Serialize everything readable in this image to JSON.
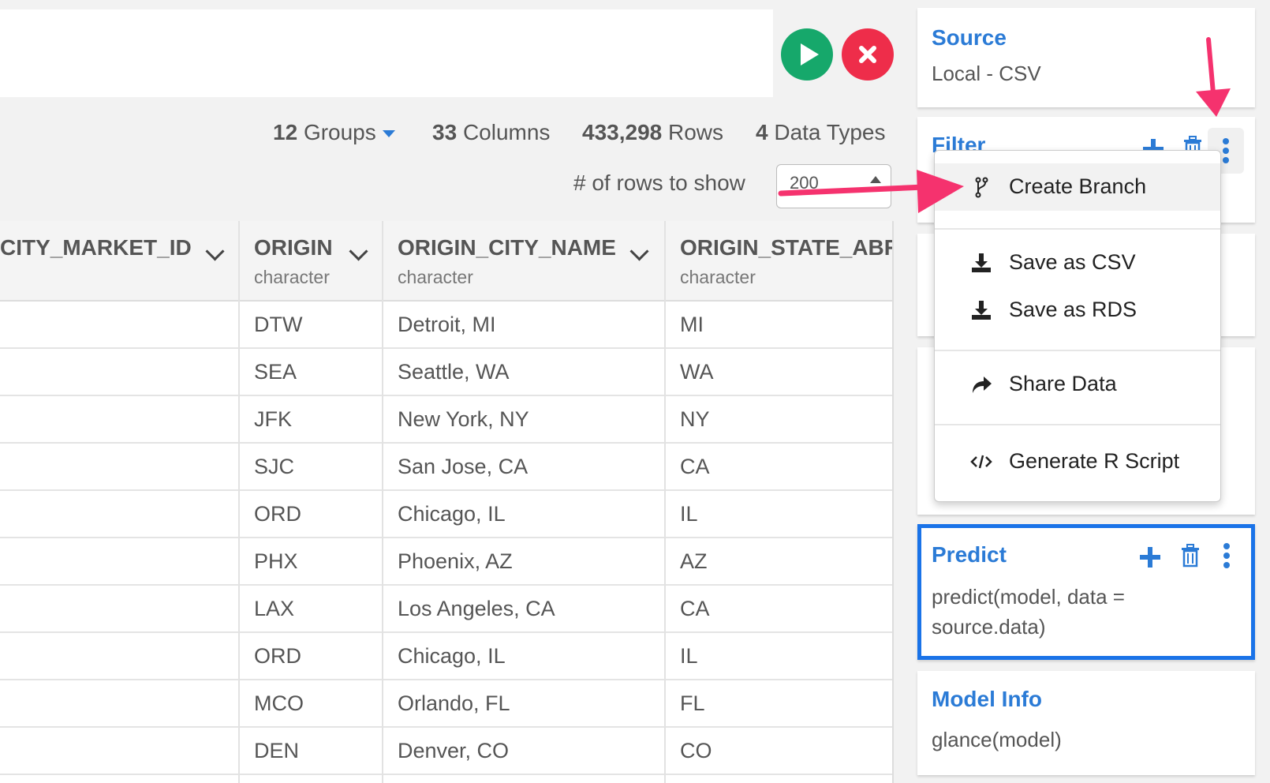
{
  "stats": {
    "groups_count": "12",
    "groups_label": "Groups",
    "columns_count": "33",
    "columns_label": "Columns",
    "rows_count": "433,298",
    "rows_label": "Rows",
    "types_count": "4",
    "types_label": "Data Types"
  },
  "rows_to_show": {
    "label": "# of rows to show",
    "value": "200"
  },
  "table": {
    "columns": [
      {
        "name": "CITY_MARKET_ID",
        "type": ""
      },
      {
        "name": "ORIGIN",
        "type": "character"
      },
      {
        "name": "ORIGIN_CITY_NAME",
        "type": "character"
      },
      {
        "name": "ORIGIN_STATE_ABR",
        "type": "character"
      }
    ],
    "rows": [
      [
        "DTW",
        "Detroit, MI",
        "MI"
      ],
      [
        "SEA",
        "Seattle, WA",
        "WA"
      ],
      [
        "JFK",
        "New York, NY",
        "NY"
      ],
      [
        "SJC",
        "San Jose, CA",
        "CA"
      ],
      [
        "ORD",
        "Chicago, IL",
        "IL"
      ],
      [
        "PHX",
        "Phoenix, AZ",
        "AZ"
      ],
      [
        "LAX",
        "Los Angeles, CA",
        "CA"
      ],
      [
        "ORD",
        "Chicago, IL",
        "IL"
      ],
      [
        "MCO",
        "Orlando, FL",
        "FL"
      ],
      [
        "DEN",
        "Denver, CO",
        "CO"
      ]
    ]
  },
  "steps": {
    "source": {
      "title": "Source",
      "body": "Local - CSV"
    },
    "filter": {
      "title": "Filter"
    },
    "predict": {
      "title": "Predict",
      "body_line1": "predict(model, data =",
      "body_line2": "source.data)"
    },
    "model_info": {
      "title": "Model Info",
      "body": "glance(model)"
    }
  },
  "menu": {
    "items": [
      {
        "label": "Create Branch",
        "icon": "branch-icon"
      },
      {
        "label": "Save as CSV",
        "icon": "download-icon"
      },
      {
        "label": "Save as RDS",
        "icon": "download-icon"
      },
      {
        "label": "Share Data",
        "icon": "share-icon"
      },
      {
        "label": "Generate R Script",
        "icon": "code-icon"
      }
    ]
  },
  "colors": {
    "accent": "#2b7bd6",
    "run": "#16a86b",
    "cancel": "#ee2d4a",
    "annotation_arrow": "#f5326e"
  }
}
